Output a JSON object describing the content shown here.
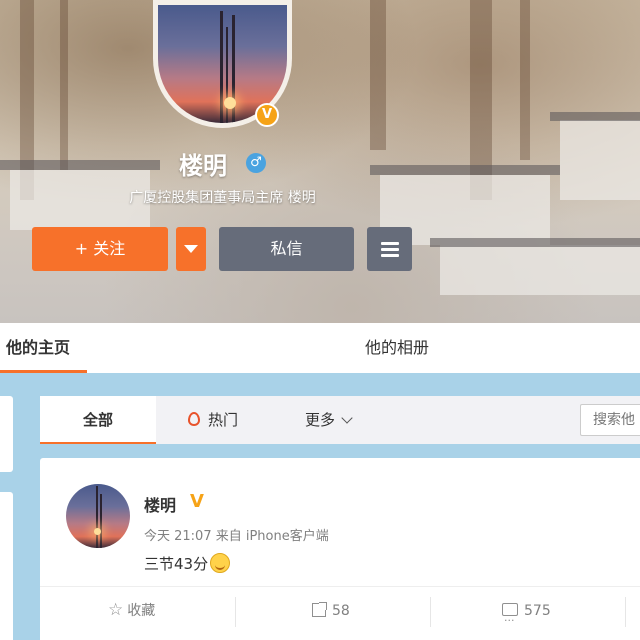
{
  "profile": {
    "name": "楼明",
    "title": "广厦控股集团董事局主席 楼明",
    "verified_badge": "V",
    "gender_icon": "male-icon",
    "gender_symbol": "♂",
    "follow_label": "+ 关注",
    "message_label": "私信"
  },
  "nav": {
    "tabs": [
      {
        "label": "他的主页",
        "active": true
      },
      {
        "label": "他的相册",
        "active": false
      }
    ]
  },
  "filter": {
    "all_label": "全部",
    "hot_label": "热门",
    "more_label": "更多",
    "search_placeholder": "搜索他"
  },
  "post": {
    "author": "楼明",
    "verified_badge": "V",
    "meta": "今天 21:07 来自 iPhone客户端",
    "text": "三节43分",
    "emoji": "smile-emoji",
    "collect_label": "收藏",
    "share_count": "58",
    "comment_count": "575"
  },
  "colors": {
    "accent": "#f7712a",
    "dark_button": "#666c7a",
    "verified": "#f6a317",
    "background": "#a9d2e8"
  }
}
